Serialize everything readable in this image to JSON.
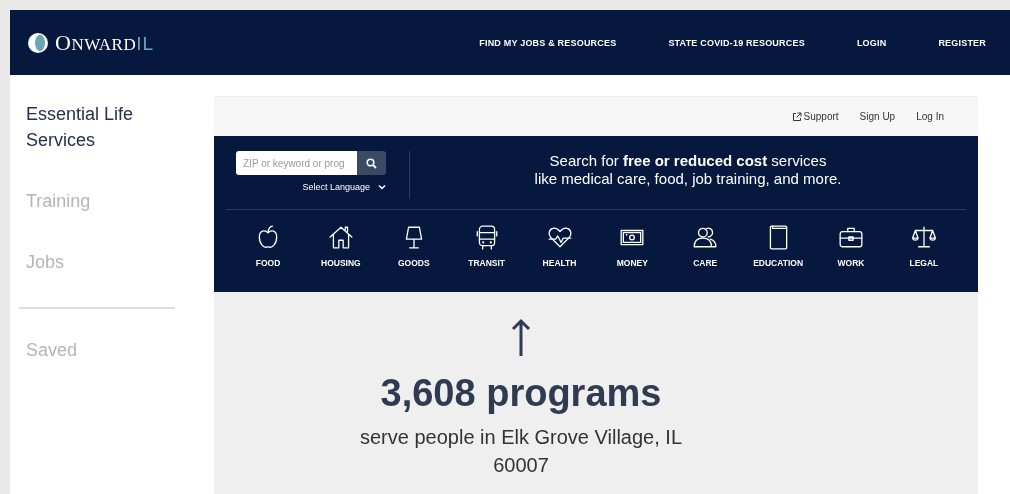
{
  "header": {
    "logo": {
      "name": "ONWARD",
      "suffix": "IL"
    },
    "nav": [
      {
        "label": "FIND MY JOBS & RESOURCES"
      },
      {
        "label": "STATE COVID-19 RESOURCES"
      },
      {
        "label": "LOGIN"
      },
      {
        "label": "REGISTER"
      }
    ]
  },
  "sidebar": {
    "items": [
      {
        "label": "Essential Life Services",
        "selected": true
      },
      {
        "label": "Training",
        "selected": false
      },
      {
        "label": "Jobs",
        "selected": false
      }
    ],
    "bottom_items": [
      {
        "label": "Saved",
        "selected": false
      }
    ]
  },
  "utility_links": [
    {
      "label": "Support",
      "external": true
    },
    {
      "label": "Sign Up",
      "external": false
    },
    {
      "label": "Log In",
      "external": false
    }
  ],
  "search": {
    "placeholder": "ZIP or keyword or prog",
    "language": "Select Language",
    "lines": [
      "Search for **free or reduced cost** services",
      "like medical care, food, job training, and more."
    ]
  },
  "categories": [
    {
      "label": "FOOD"
    },
    {
      "label": "HOUSING"
    },
    {
      "label": "GOODS"
    },
    {
      "label": "TRANSIT"
    },
    {
      "label": "HEALTH"
    },
    {
      "label": "MONEY"
    },
    {
      "label": "CARE"
    },
    {
      "label": "EDUCATION"
    },
    {
      "label": "WORK"
    },
    {
      "label": "LEGAL"
    }
  ],
  "results": {
    "count": "3,608 programs",
    "location": "serve people in Elk Grove Village, IL 60007"
  }
}
